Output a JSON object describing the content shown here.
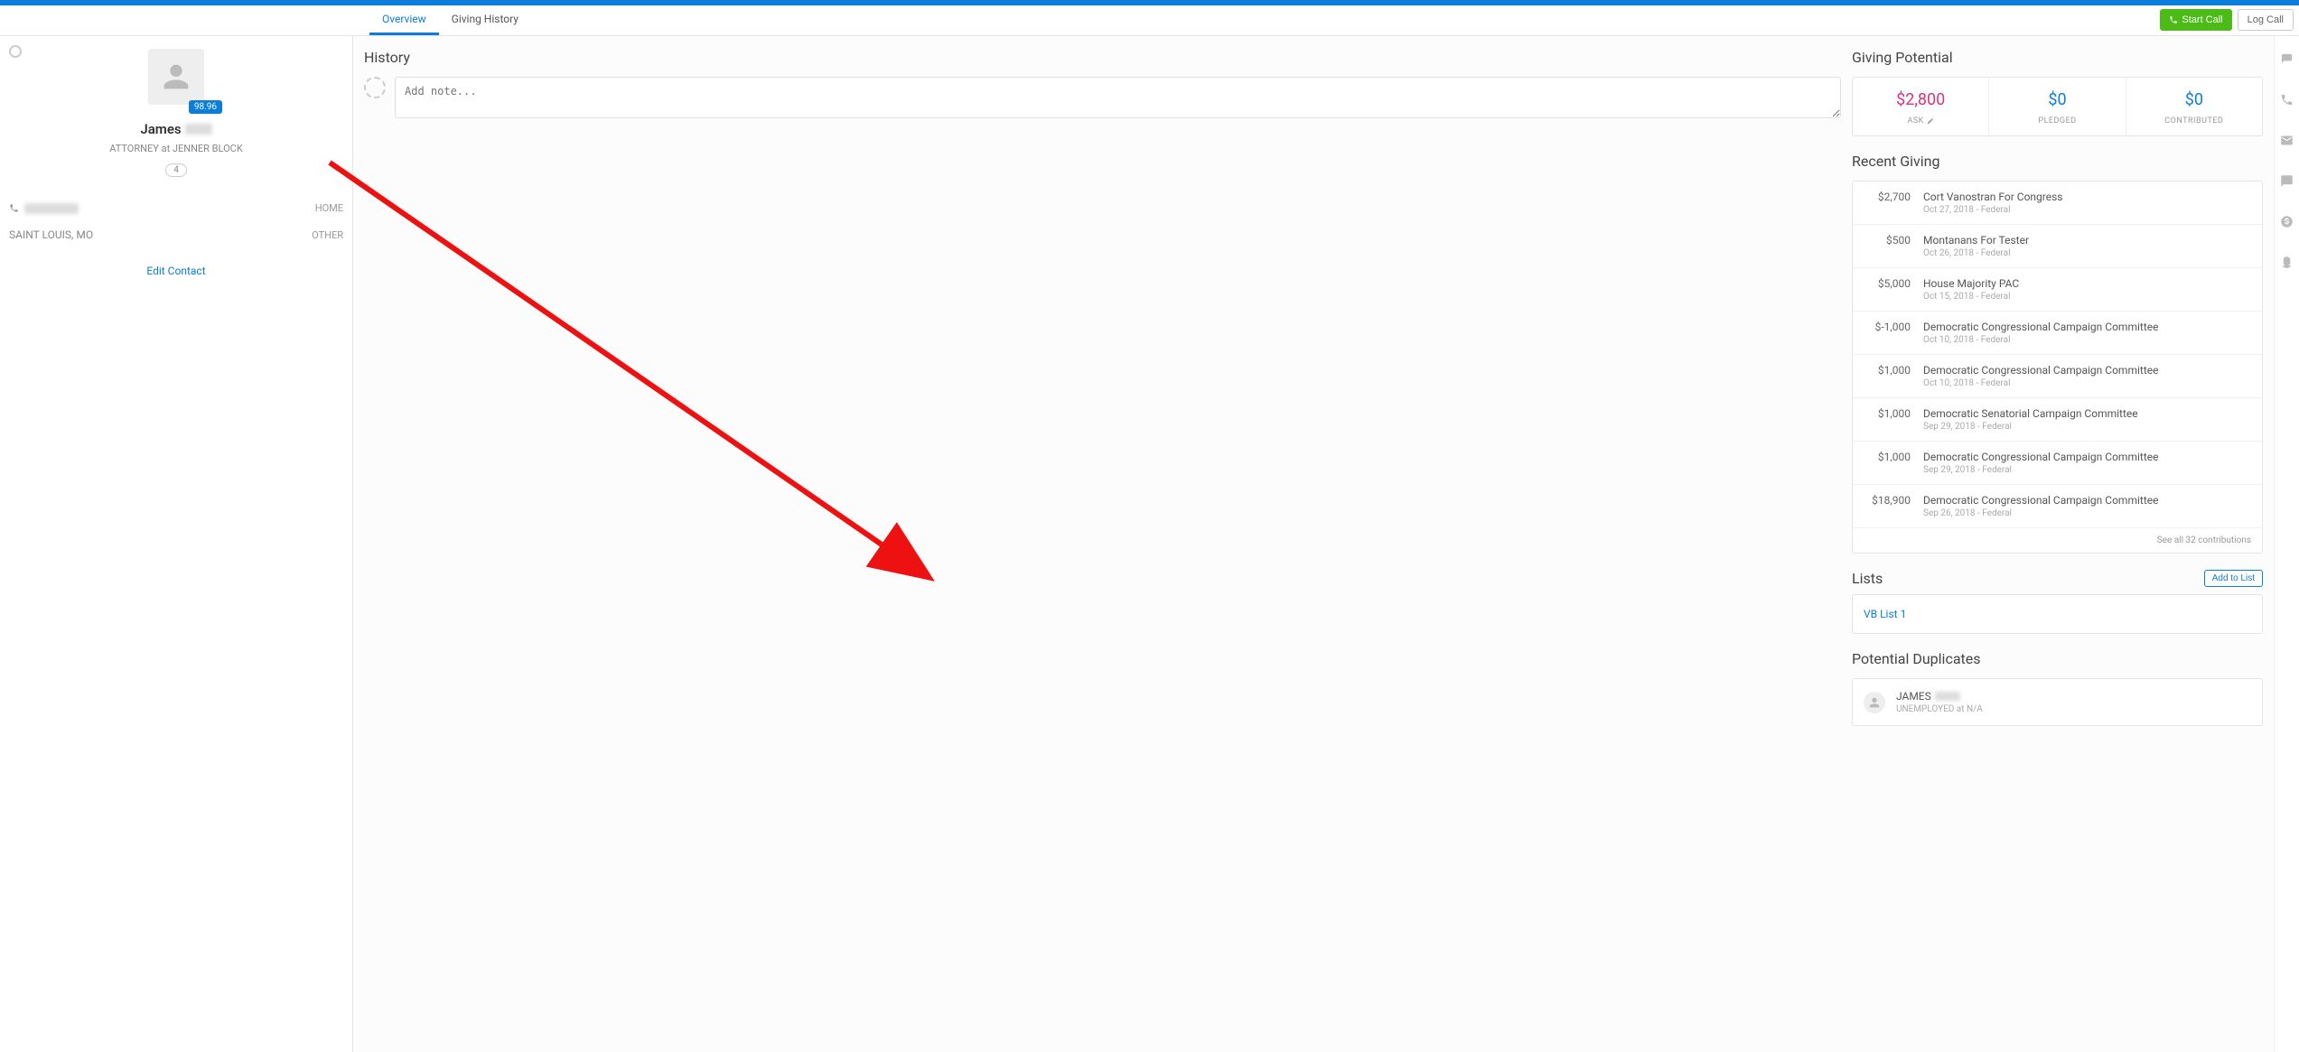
{
  "header": {
    "tabs": [
      {
        "label": "Overview",
        "active": true
      },
      {
        "label": "Giving History",
        "active": false
      }
    ],
    "start_call": "Start Call",
    "log_call": "Log Call"
  },
  "contact": {
    "first_name": "James",
    "score_badge": "98.96",
    "subtitle": "ATTORNEY at JENNER BLOCK",
    "count_badge": "4",
    "phone_type": "HOME",
    "city": "SAINT LOUIS, MO",
    "addr_type": "OTHER",
    "edit_label": "Edit Contact"
  },
  "history": {
    "title": "History",
    "note_placeholder": "Add note..."
  },
  "giving_potential": {
    "title": "Giving Potential",
    "cells": [
      {
        "amount": "$2,800",
        "label": "ASK",
        "color": "pink",
        "editable": true
      },
      {
        "amount": "$0",
        "label": "PLEDGED",
        "color": "blue",
        "editable": false
      },
      {
        "amount": "$0",
        "label": "CONTRIBUTED",
        "color": "blue",
        "editable": false
      }
    ]
  },
  "recent_giving": {
    "title": "Recent Giving",
    "items": [
      {
        "amount": "$2,700",
        "org": "Cort Vanostran For Congress",
        "date": "Oct 27, 2018 - Federal"
      },
      {
        "amount": "$500",
        "org": "Montanans For Tester",
        "date": "Oct 26, 2018 - Federal"
      },
      {
        "amount": "$5,000",
        "org": "House Majority PAC",
        "date": "Oct 15, 2018 - Federal"
      },
      {
        "amount": "$-1,000",
        "org": "Democratic Congressional Campaign Committee",
        "date": "Oct 10, 2018 - Federal"
      },
      {
        "amount": "$1,000",
        "org": "Democratic Congressional Campaign Committee",
        "date": "Oct 10, 2018 - Federal"
      },
      {
        "amount": "$1,000",
        "org": "Democratic Senatorial Campaign Committee",
        "date": "Sep 29, 2018 - Federal"
      },
      {
        "amount": "$1,000",
        "org": "Democratic Congressional Campaign Committee",
        "date": "Sep 29, 2018 - Federal"
      },
      {
        "amount": "$18,900",
        "org": "Democratic Congressional Campaign Committee",
        "date": "Sep 26, 2018 - Federal"
      }
    ],
    "footer": "See all 32 contributions"
  },
  "lists": {
    "title": "Lists",
    "add_label": "Add to List",
    "items": [
      "VB List 1"
    ]
  },
  "duplicates": {
    "title": "Potential Duplicates",
    "items": [
      {
        "name": "JAMES",
        "sub": "UNEMPLOYED at N/A"
      }
    ]
  }
}
